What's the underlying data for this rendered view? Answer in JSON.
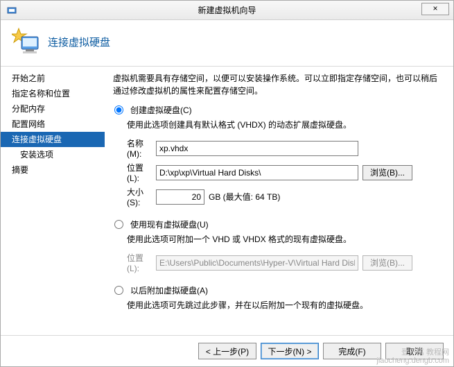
{
  "window": {
    "title": "新建虚拟机向导",
    "close_glyph": "×"
  },
  "header": {
    "title": "连接虚拟硬盘"
  },
  "sidebar": {
    "items": [
      {
        "label": "开始之前"
      },
      {
        "label": "指定名称和位置"
      },
      {
        "label": "分配内存"
      },
      {
        "label": "配置网络"
      },
      {
        "label": "连接虚拟硬盘",
        "active": true
      },
      {
        "label": "安装选项",
        "sub": true
      },
      {
        "label": "摘要"
      }
    ]
  },
  "content": {
    "description": "虚拟机需要具有存储空间，以便可以安装操作系统。可以立即指定存储空间，也可以稍后通过修改虚拟机的属性来配置存储空间。",
    "option_create": {
      "label": "创建虚拟硬盘(C)",
      "hint": "使用此选项创建具有默认格式 (VHDX) 的动态扩展虚拟硬盘。",
      "name_label": "名称(M):",
      "name_value": "xp.vhdx",
      "location_label": "位置(L):",
      "location_value": "D:\\xp\\xp\\Virtual Hard Disks\\",
      "browse_label": "浏览(B)...",
      "size_label": "大小(S):",
      "size_value": "20",
      "size_suffix": "GB (最大值: 64 TB)"
    },
    "option_existing": {
      "label": "使用现有虚拟硬盘(U)",
      "hint": "使用此选项可附加一个 VHD 或 VHDX 格式的现有虚拟硬盘。",
      "location_label": "位置(L):",
      "location_value": "E:\\Users\\Public\\Documents\\Hyper-V\\Virtual Hard Disks\\",
      "browse_label": "浏览(B)..."
    },
    "option_later": {
      "label": "以后附加虚拟硬盘(A)",
      "hint": "使用此选项可先跳过此步骤，并在以后附加一个现有的虚拟硬盘。"
    }
  },
  "footer": {
    "back": "< 上一步(P)",
    "next": "下一步(N) >",
    "finish": "完成(F)",
    "cancel": "取消"
  },
  "watermark": {
    "line1": "登不离 教程网",
    "line2": "jiaocheng.dengb.com"
  }
}
